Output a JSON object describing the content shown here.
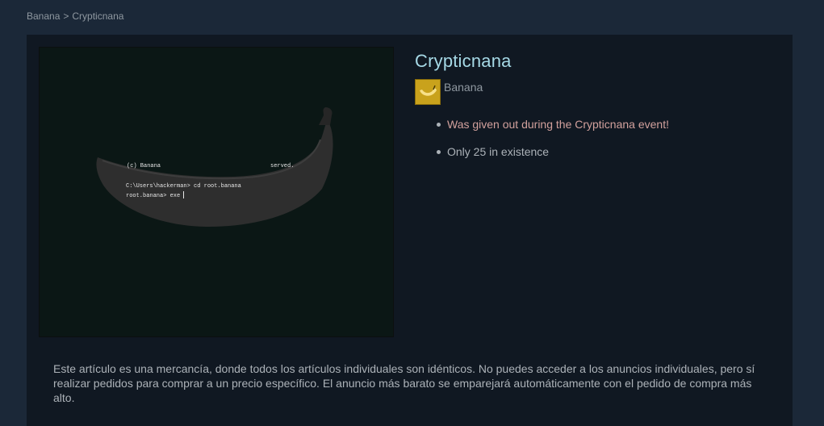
{
  "breadcrumb": {
    "game": "Banana",
    "separator": ">",
    "item": "Crypticnana"
  },
  "item": {
    "title": "Crypticnana",
    "game_name": "Banana",
    "game_icon": "banana-game-icon",
    "descriptions": [
      {
        "text": "Was given out during the Crypticnana event!",
        "color": "#d2a19d"
      },
      {
        "text": "Only 25 in existence",
        "color": "#acb2b8"
      }
    ],
    "image": {
      "terminal_lines": [
        "(c) Banana",
        "served.",
        "C:\\Users\\hackerman> cd root.banana",
        "root.banana> exe"
      ]
    }
  },
  "commodity_notice": "Este artículo es una mercancía, donde todos los artículos individuales son idénticos. No puedes acceder a los anuncios individuales, pero sí realizar pedidos para comprar a un precio específico. El anuncio más barato se emparejará automáticamente con el pedido de compra más alto.",
  "colors": {
    "background": "#1b2838",
    "panel": "#101822",
    "title": "#a6d9e6",
    "event_text": "#d2a19d",
    "body_text": "#acb2b8"
  }
}
